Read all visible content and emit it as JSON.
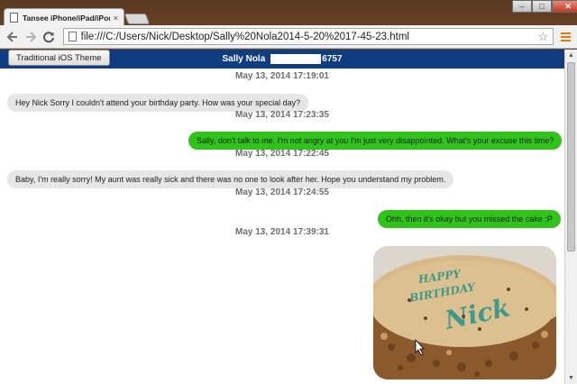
{
  "browser": {
    "tab_title": "Tansee iPhone/iPad/iPod",
    "tab_close": "×",
    "url": "file:///C:/Users/Nick/Desktop/Sally%20Nola2014-5-20%2017-45-23.html",
    "window_minimize": "–",
    "window_maximize": "□",
    "window_close": "✕"
  },
  "header": {
    "theme_button": "Traditional iOS Theme",
    "contact_name": "Sally Nola",
    "contact_number_suffix": "6757"
  },
  "messages": [
    {
      "type": "timestamp",
      "text": "May 13, 2014 17:19:01"
    },
    {
      "type": "incoming",
      "text": "Hey Nick Sorry I couldn't attend your birthday party. How was your special day?"
    },
    {
      "type": "timestamp",
      "text": "May 13, 2014 17:23:35"
    },
    {
      "type": "outgoing",
      "text": "Sally, don't talk to me. I'm not angry at you I'm just very disappointed. What's your excuse this time?"
    },
    {
      "type": "timestamp",
      "text": "May 13, 2014 17:22:45"
    },
    {
      "type": "incoming",
      "text": "Baby, I'm really sorry! My aunt was really sick and there was no one to look after her. Hope you understand my problem."
    },
    {
      "type": "timestamp",
      "text": "May 13, 2014 17:24:55"
    },
    {
      "type": "outgoing",
      "text": "Ohh, then it's okay but you missed the cake :P"
    },
    {
      "type": "timestamp",
      "text": "May 13, 2014 17:39:31"
    },
    {
      "type": "outgoing-image",
      "image": "birthday-cake-photo",
      "cake_text": [
        "HAPPY",
        "BIRTHDAY",
        "Nick"
      ]
    }
  ],
  "colors": {
    "header_bar": "#103d80",
    "outgoing_bubble": "#31c21b",
    "incoming_bubble": "#e6e6e6",
    "menu_accent": "#e07a10"
  }
}
